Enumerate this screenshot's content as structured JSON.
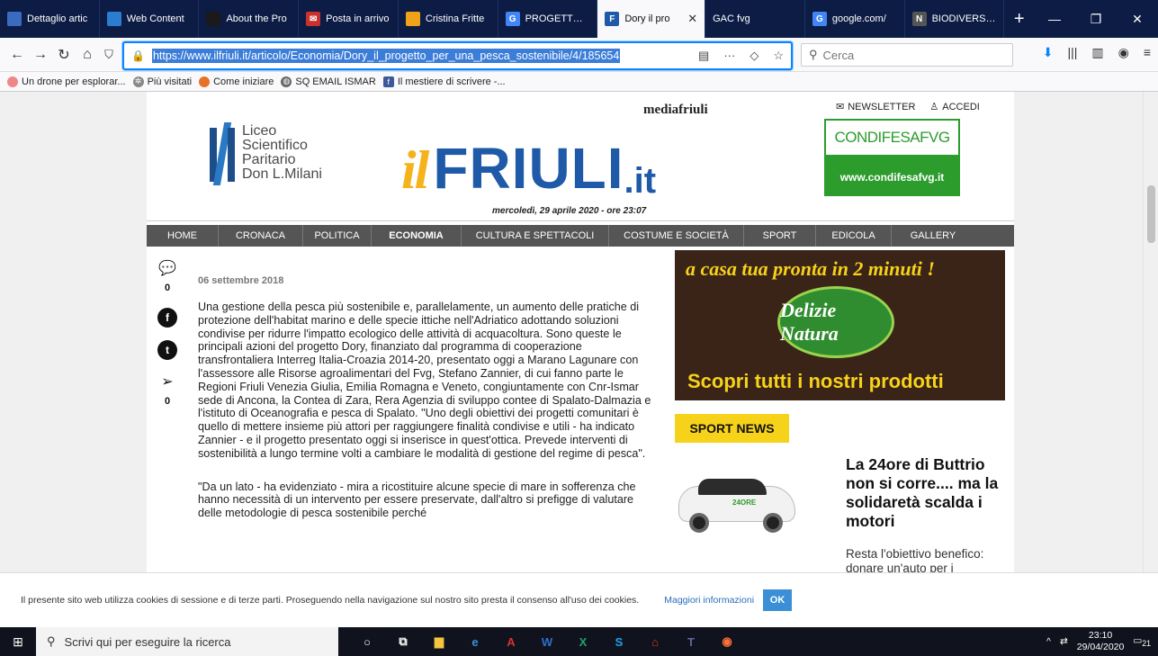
{
  "browser": {
    "tabs": [
      {
        "label": "Dettaglio artic",
        "color": "#3b6bbf"
      },
      {
        "label": "Web Content",
        "color": "#2a7dd1"
      },
      {
        "label": "About the Pro",
        "color": "#1a1a1a"
      },
      {
        "label": "Posta in arrivo",
        "color": "#c8312d"
      },
      {
        "label": "Cristina Fritte",
        "color": "#f0a21a"
      },
      {
        "label": "PROGETTO DO",
        "color": "#4285f4"
      },
      {
        "label": "Dory il pro",
        "color": "#1e5aa8",
        "active": true
      },
      {
        "label": "GAC fvg",
        "color": "#0c1c44"
      },
      {
        "label": "google.com/",
        "color": "#4285f4"
      },
      {
        "label": "BIODIVERSITA",
        "color": "#111111"
      }
    ],
    "url": "https://www.ilfriuli.it/articolo/Economia/Dory_il_progetto_per_una_pesca_sostenibile/4/185654",
    "search_placeholder": "Cerca",
    "bookmarks": [
      "Un drone per esplorar...",
      "Più visitati",
      "Come iniziare",
      "SQ EMAIL ISMAR",
      "Il mestiere di scrivere -..."
    ]
  },
  "site": {
    "liceo": [
      "Liceo",
      "Scientifico",
      "Paritario",
      "Don L.Milani"
    ],
    "mediafriuli": "mediafriuli",
    "newsletter": "NEWSLETTER",
    "accedi": "ACCEDI",
    "logo_il": "il",
    "logo_friuli": "FRIULI",
    "logo_it": ".it",
    "date": "mercoledì, 29 aprile 2020 - ore 23:07",
    "condifesa_title": "CONDIFESAFVG",
    "condifesa_url": "www.condifesafvg.it",
    "nav": [
      "HOME",
      "CRONACA",
      "POLITICA",
      "ECONOMIA",
      "CULTURA E SPETTACOLI",
      "COSTUME E SOCIETÀ",
      "SPORT",
      "EDICOLA",
      "GALLERY"
    ],
    "active_nav": "ECONOMIA"
  },
  "article": {
    "date": "06 settembre 2018",
    "comments_count": "0",
    "share_count": "0",
    "paragraph1": "Una gestione della pesca più sostenibile e, parallelamente, un aumento delle pratiche di protezione dell'habitat marino e delle specie ittiche nell'Adriatico adottando soluzioni condivise per ridurre l'impatto ecologico delle attività di acquacoltura. Sono queste le principali azioni del progetto Dory, finanziato dal programma di cooperazione transfrontaliera Interreg Italia-Croazia 2014-20, presentato oggi a Marano Lagunare con l'assessore alle Risorse agroalimentari del Fvg, Stefano Zannier, di cui fanno parte le Regioni Friuli Venezia Giulia, Emilia Romagna e Veneto, congiuntamente con Cnr-Ismar sede di Ancona, la Contea di Zara, Rera Agenzia di sviluppo contee di Spalato-Dalmazia e l'istituto di Oceanografia e pesca di Spalato. \"Uno degli obiettivi dei progetti comunitari è quello di mettere insieme più attori per raggiungere finalità condivise e utili - ha indicato Zannier - e il progetto presentato oggi si inserisce in quest'ottica. Prevede interventi di sostenibilità a lungo termine volti a cambiare le modalità di gestione del regime di pesca\".",
    "paragraph2": "\"Da un lato - ha evidenziato - mira a ricostituire alcune specie di mare in sofferenza che hanno necessità di un intervento per essere preservate, dall'altro si prefigge di valutare delle metodologie di pesca sostenibile perché"
  },
  "ad": {
    "headline": "a casa tua pronta in 2 minuti !",
    "brand": "Delizie Natura",
    "cta": "Scopri tutti i nostri prodotti"
  },
  "sport": {
    "badge": "SPORT NEWS",
    "car_logo": "24ORE",
    "title": "La 24ore di Buttrio non si corre.... ma la solidaretà scalda i motori",
    "subtitle": "Resta l'obiettivo benefico: donare un'auto per i"
  },
  "cookie": {
    "text": "Il presente sito web utilizza cookies di sessione e di terze parti. Proseguendo nella navigazione sul nostro sito presta il consenso all'uso dei cookies.",
    "more": "Maggiori informazioni",
    "ok": "OK"
  },
  "taskbar": {
    "search_placeholder": "Scrivi qui per eseguire la ricerca",
    "time": "23:10",
    "date": "29/04/2020",
    "notifications": "21"
  }
}
